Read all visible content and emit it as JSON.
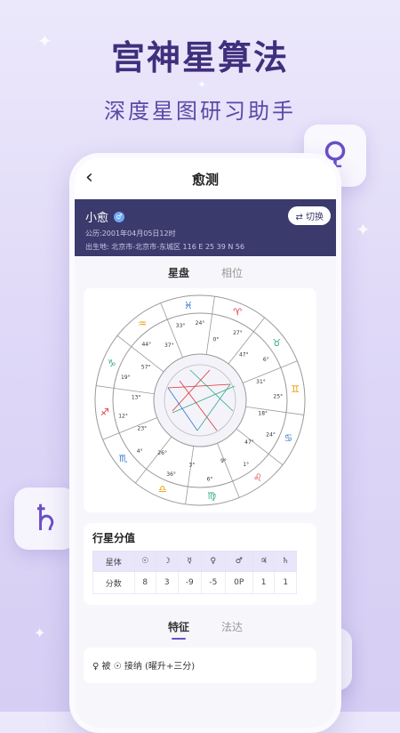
{
  "hero": {
    "title": "宫神星算法",
    "subtitle": "深度星图研习助手"
  },
  "float_icons": {
    "venus": "♀",
    "saturn": "♄",
    "mercury": "☿"
  },
  "nav": {
    "back": "‹",
    "title": "愈测"
  },
  "profile": {
    "name": "小愈",
    "date_line": "公历:2001年04月05日12时",
    "place_line": "出生地: 北京市-北京市-东城区   116 E 25 39 N 56",
    "switch_label": "切换"
  },
  "tabs": [
    "星盘",
    "相位"
  ],
  "chart": {
    "signs": [
      "♈",
      "♉",
      "♊",
      "♋",
      "♌",
      "♍",
      "♎",
      "♏",
      "♐",
      "♑",
      "♒",
      "♓"
    ],
    "degree_labels": [
      "24°",
      "0°",
      "27°",
      "47°",
      "6°",
      "31°",
      "25°",
      "18°",
      "24°",
      "47°",
      "1°",
      "9°",
      "6°",
      "3°",
      "36°",
      "26°",
      "4°",
      "23°",
      "12°",
      "13°",
      "19°",
      "57°",
      "44°",
      "37°",
      "33°"
    ]
  },
  "scores": {
    "title": "行星分值",
    "header_label": "星体",
    "row_label": "分数",
    "planets": [
      "☉",
      "☽",
      "☿",
      "♀",
      "♂",
      "♃",
      "♄"
    ],
    "values": [
      "8",
      "3",
      "-9",
      "-5",
      "0P",
      "1",
      "1"
    ]
  },
  "tabs2": [
    "特征",
    "法达"
  ],
  "feature": {
    "text": "♀ 被 ☉ 接纳 (曜升+三分)"
  },
  "colors": {
    "accent": "#6a4fc6",
    "title": "#3f2f7d",
    "profile_bg": "#3a3a6c"
  }
}
